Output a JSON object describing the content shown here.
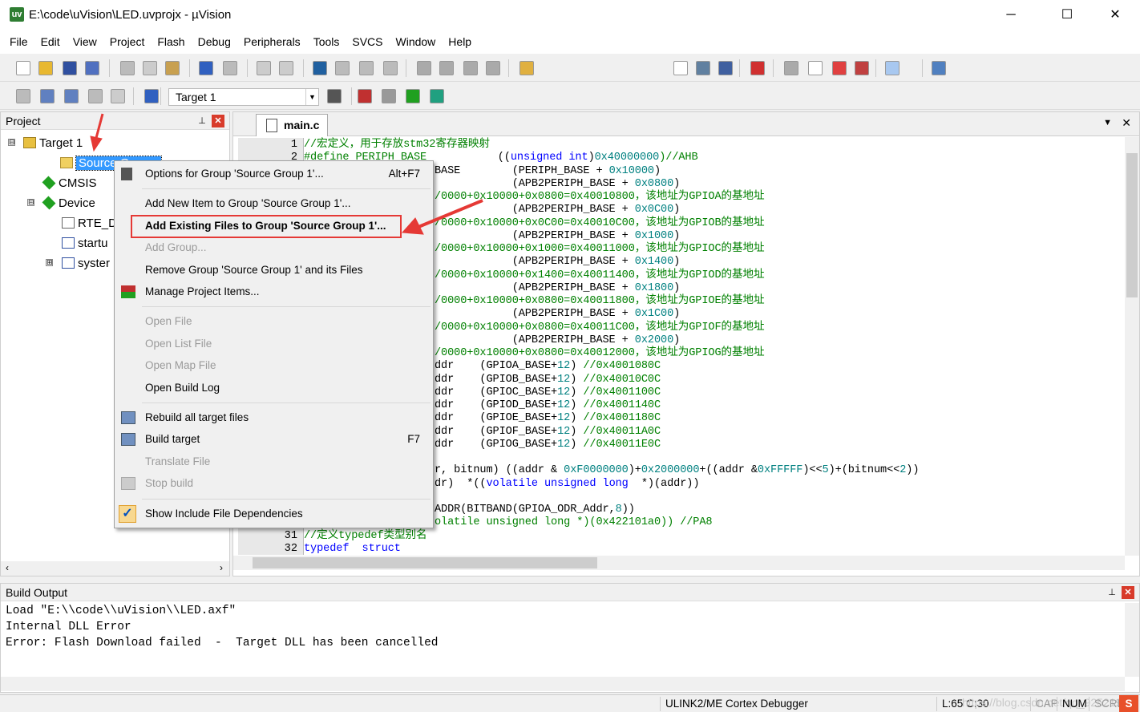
{
  "window": {
    "title": "E:\\code\\uVision\\LED.uvprojx - µVision",
    "app_icon": "uv",
    "minimize": "─",
    "maximize": "☐",
    "close": "✕"
  },
  "menubar": [
    "File",
    "Edit",
    "View",
    "Project",
    "Flash",
    "Debug",
    "Peripherals",
    "Tools",
    "SVCS",
    "Window",
    "Help"
  ],
  "toolbar2": {
    "target": "Target 1"
  },
  "project_panel": {
    "title": "Project",
    "pin": "⊥",
    "close": "✕",
    "tree": [
      {
        "label": "Target 1",
        "icon": "target-folder-icon"
      },
      {
        "label": "Source G",
        "icon": "folder-icon",
        "selected": true
      },
      {
        "label": "CMSIS",
        "icon": "green-diamond-icon"
      },
      {
        "label": "Device",
        "icon": "green-diamond-icon"
      },
      {
        "label": "RTE_D",
        "icon": "file-icon"
      },
      {
        "label": "startu",
        "icon": "asm-file-icon"
      },
      {
        "label": "syster",
        "icon": "c-file-icon"
      }
    ]
  },
  "editor": {
    "tab": "main.c",
    "tab_menu": "▼",
    "close": "✕",
    "lines": [
      {
        "n": "1",
        "seg": [
          [
            "//宏定义，用于存放stm32寄存器映射",
            "c"
          ]
        ]
      },
      {
        "n": "2",
        "seg": [
          [
            "#define PERIPH_BASE           ",
            "c"
          ],
          [
            "((",
            "p"
          ],
          [
            "unsigned int",
            "k"
          ],
          [
            ")",
            "p"
          ],
          [
            "0x40000000",
            "n"
          ],
          [
            ")//AHB",
            "c"
          ]
        ]
      },
      {
        "n": "",
        "seg": [
          [
            "BASE        (PERIPH_BASE + ",
            "p"
          ],
          [
            "0x10000",
            "n"
          ],
          [
            ")",
            "p"
          ]
        ]
      },
      {
        "n": "",
        "seg": [
          [
            "            (APB2PERIPH_BASE + ",
            "p"
          ],
          [
            "0x0800",
            "n"
          ],
          [
            ")",
            "p"
          ]
        ]
      },
      {
        "n": "",
        "seg": [
          [
            "/0000+0x10000+0x0800=0x40010800，该地址为GPIOA的基地址",
            "c"
          ]
        ]
      },
      {
        "n": "",
        "seg": [
          [
            "            (APB2PERIPH_BASE + ",
            "p"
          ],
          [
            "0x0C00",
            "n"
          ],
          [
            ")",
            "p"
          ]
        ]
      },
      {
        "n": "",
        "seg": [
          [
            "/0000+0x10000+0x0C00=0x40010C00，该地址为GPIOB的基地址",
            "c"
          ]
        ]
      },
      {
        "n": "",
        "seg": [
          [
            "            (APB2PERIPH_BASE + ",
            "p"
          ],
          [
            "0x1000",
            "n"
          ],
          [
            ")",
            "p"
          ]
        ]
      },
      {
        "n": "",
        "seg": [
          [
            "/0000+0x10000+0x1000=0x40011000，该地址为GPIOC的基地址",
            "c"
          ]
        ]
      },
      {
        "n": "",
        "seg": [
          [
            "            (APB2PERIPH_BASE + ",
            "p"
          ],
          [
            "0x1400",
            "n"
          ],
          [
            ")",
            "p"
          ]
        ]
      },
      {
        "n": "",
        "seg": [
          [
            "/0000+0x10000+0x1400=0x40011400，该地址为GPIOD的基地址",
            "c"
          ]
        ]
      },
      {
        "n": "",
        "seg": [
          [
            "            (APB2PERIPH_BASE + ",
            "p"
          ],
          [
            "0x1800",
            "n"
          ],
          [
            ")",
            "p"
          ]
        ]
      },
      {
        "n": "",
        "seg": [
          [
            "/0000+0x10000+0x0800=0x40011800，该地址为GPIOE的基地址",
            "c"
          ]
        ]
      },
      {
        "n": "",
        "seg": [
          [
            "            (APB2PERIPH_BASE + ",
            "p"
          ],
          [
            "0x1C00",
            "n"
          ],
          [
            ")",
            "p"
          ]
        ]
      },
      {
        "n": "",
        "seg": [
          [
            "/0000+0x10000+0x0800=0x40011C00，该地址为GPIOF的基地址",
            "c"
          ]
        ]
      },
      {
        "n": "",
        "seg": [
          [
            "            (APB2PERIPH_BASE + ",
            "p"
          ],
          [
            "0x2000",
            "n"
          ],
          [
            ")",
            "p"
          ]
        ]
      },
      {
        "n": "",
        "seg": [
          [
            "/0000+0x10000+0x0800=0x40012000，该地址为GPIOG的基地址",
            "c"
          ]
        ]
      },
      {
        "n": "",
        "seg": [
          [
            "ddr    (GPIOA_BASE+",
            "p"
          ],
          [
            "12",
            "n"
          ],
          [
            ") ",
            "p"
          ],
          [
            "//0x4001080C",
            "c"
          ]
        ]
      },
      {
        "n": "",
        "seg": [
          [
            "ddr    (GPIOB_BASE+",
            "p"
          ],
          [
            "12",
            "n"
          ],
          [
            ") ",
            "p"
          ],
          [
            "//0x40010C0C",
            "c"
          ]
        ]
      },
      {
        "n": "",
        "seg": [
          [
            "ddr    (GPIOC_BASE+",
            "p"
          ],
          [
            "12",
            "n"
          ],
          [
            ") ",
            "p"
          ],
          [
            "//0x4001100C",
            "c"
          ]
        ]
      },
      {
        "n": "",
        "seg": [
          [
            "ddr    (GPIOD_BASE+",
            "p"
          ],
          [
            "12",
            "n"
          ],
          [
            ") ",
            "p"
          ],
          [
            "//0x4001140C",
            "c"
          ]
        ]
      },
      {
        "n": "",
        "seg": [
          [
            "ddr    (GPIOE_BASE+",
            "p"
          ],
          [
            "12",
            "n"
          ],
          [
            ") ",
            "p"
          ],
          [
            "//0x4001180C",
            "c"
          ]
        ]
      },
      {
        "n": "",
        "seg": [
          [
            "ddr    (GPIOF_BASE+",
            "p"
          ],
          [
            "12",
            "n"
          ],
          [
            ") ",
            "p"
          ],
          [
            "//0x40011A0C",
            "c"
          ]
        ]
      },
      {
        "n": "",
        "seg": [
          [
            "ddr    (GPIOG_BASE+",
            "p"
          ],
          [
            "12",
            "n"
          ],
          [
            ") ",
            "p"
          ],
          [
            "//0x40011E0C",
            "c"
          ]
        ]
      },
      {
        "n": "",
        "seg": []
      },
      {
        "n": "",
        "seg": [
          [
            "r, bitnum) ((addr & ",
            "p"
          ],
          [
            "0xF0000000",
            "n"
          ],
          [
            ")+",
            "p"
          ],
          [
            "0x2000000",
            "n"
          ],
          [
            "+((addr &",
            "p"
          ],
          [
            "0xFFFFF",
            "n"
          ],
          [
            ")<<",
            "p"
          ],
          [
            "5",
            "n"
          ],
          [
            ")+(bitnum<<",
            "p"
          ],
          [
            "2",
            "n"
          ],
          [
            "))",
            "p"
          ]
        ]
      },
      {
        "n": "",
        "seg": [
          [
            "dr)  *((",
            "p"
          ],
          [
            "volatile unsigned long",
            "k"
          ],
          [
            "  *)(addr))",
            "p"
          ]
        ]
      },
      {
        "n": "",
        "seg": []
      },
      {
        "n": "",
        "seg": [
          [
            "ADDR(BITBAND(GPIOA_ODR_Addr,",
            "p"
          ],
          [
            "8",
            "n"
          ],
          [
            "))",
            "p"
          ]
        ]
      },
      {
        "n": "",
        "seg": [
          [
            "olatile unsigned long *)(0x422101a0)) //PA8",
            "c"
          ]
        ]
      },
      {
        "n": "31",
        "seg": [
          [
            "//定义typedef类型别名",
            "c"
          ]
        ]
      },
      {
        "n": "32",
        "seg": [
          [
            "typedef  struct",
            "k"
          ]
        ]
      }
    ]
  },
  "context_menu": {
    "items": [
      {
        "label": "Options for Group 'Source Group 1'...",
        "shortcut": "Alt+F7",
        "icon": "options-wand-icon"
      },
      {
        "sep": true
      },
      {
        "label": "Add New  Item to Group 'Source Group 1'..."
      },
      {
        "label": "Add Existing Files to Group 'Source Group 1'...",
        "bold": true,
        "highlighted": true
      },
      {
        "label": "Add Group...",
        "disabled": true
      },
      {
        "label": "Remove Group 'Source Group 1' and its Files"
      },
      {
        "label": "Manage Project Items...",
        "icon": "manage-items-icon"
      },
      {
        "sep": true
      },
      {
        "label": "Open File",
        "disabled": true
      },
      {
        "label": "Open List File",
        "disabled": true
      },
      {
        "label": "Open Map File",
        "disabled": true
      },
      {
        "label": "Open Build Log"
      },
      {
        "sep": true
      },
      {
        "label": "Rebuild all target files",
        "icon": "rebuild-icon"
      },
      {
        "label": "Build target",
        "shortcut": "F7",
        "icon": "build-icon"
      },
      {
        "label": "Translate File",
        "disabled": true
      },
      {
        "label": "Stop build",
        "disabled": true,
        "icon": "stop-build-icon"
      },
      {
        "sep": true
      },
      {
        "label": "Show Include File Dependencies",
        "icon": "checkmark-icon",
        "checked": true
      }
    ]
  },
  "build_output": {
    "title": "Build Output",
    "lines": [
      "Load \"E:\\\\code\\\\uVision\\\\LED.axf\"",
      "Internal DLL Error",
      "Error: Flash Download failed  -  Target DLL has been cancelled"
    ]
  },
  "statusbar": {
    "debugger": "ULINK2/ME Cortex Debugger",
    "position": "L:65 C:30",
    "cap": "CAP",
    "num": "NUM",
    "scrl": "SCRL",
    "watermark": "https://blog.csdn.net/qq_925219"
  },
  "colors": {
    "comment": "#008000",
    "keyword": "#0000ff",
    "number": "#008080",
    "selection": "#3399ff",
    "annotation": "#e53935"
  }
}
